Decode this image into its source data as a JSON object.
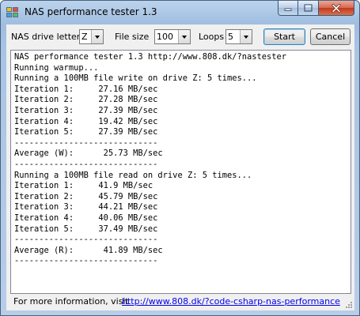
{
  "window": {
    "title": "NAS performance tester 1.3"
  },
  "controls": {
    "drive_label": "NAS drive letter",
    "drive_value": "Z",
    "filesize_label": "File size",
    "filesize_value": "100",
    "loops_label": "Loops",
    "loops_value": "5",
    "start_label": "Start",
    "cancel_label": "Cancel"
  },
  "output": {
    "lines": [
      "NAS performance tester 1.3 http://www.808.dk/?nastester",
      "Running warmup...",
      "Running a 100MB file write on drive Z: 5 times...",
      "Iteration 1:     27.16 MB/sec",
      "Iteration 2:     27.28 MB/sec",
      "Iteration 3:     27.39 MB/sec",
      "Iteration 4:     19.42 MB/sec",
      "Iteration 5:     27.39 MB/sec",
      "-----------------------------",
      "Average (W):      25.73 MB/sec",
      "-----------------------------",
      "Running a 100MB file read on drive Z: 5 times...",
      "Iteration 1:     41.9 MB/sec",
      "Iteration 2:     45.79 MB/sec",
      "Iteration 3:     44.21 MB/sec",
      "Iteration 4:     40.06 MB/sec",
      "Iteration 5:     37.49 MB/sec",
      "-----------------------------",
      "Average (R):      41.89 MB/sec",
      "-----------------------------"
    ]
  },
  "footer": {
    "info_text": "For more information, visit",
    "link_text": "http://www.808.dk/?code-csharp-nas-performance"
  },
  "icons": [
    "app-icon",
    "minimize-icon",
    "maximize-icon",
    "close-icon",
    "chevron-down-icon",
    "resize-grip-icon"
  ]
}
